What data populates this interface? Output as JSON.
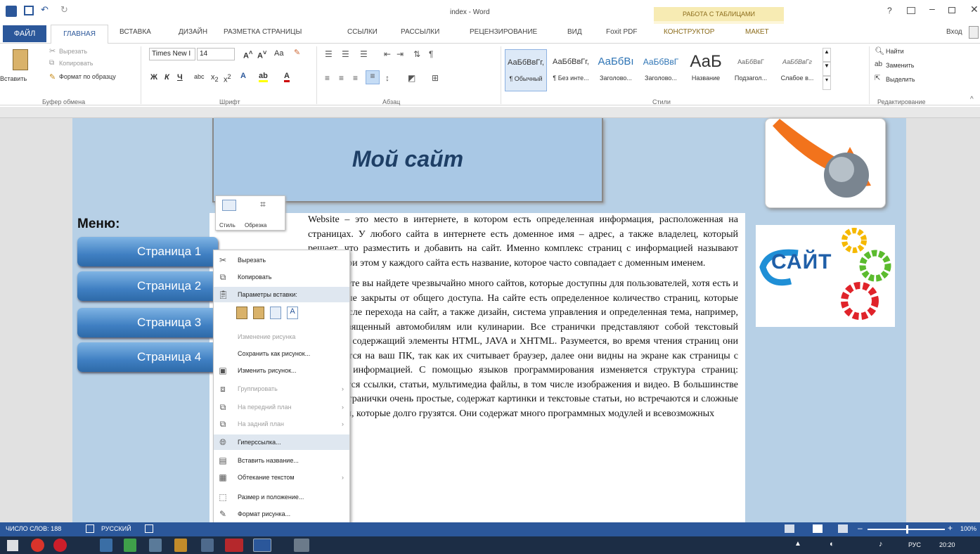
{
  "window": {
    "title": "index - Word",
    "table_tools": "РАБОТА С ТАБЛИЦАМИ",
    "help": "?",
    "signin": "Вход"
  },
  "tabs": {
    "file": "ФАЙЛ",
    "home": "ГЛАВНАЯ",
    "insert": "ВСТАВКА",
    "design": "ДИЗАЙН",
    "layout": "РАЗМЕТКА СТРАНИЦЫ",
    "references": "ССЫЛКИ",
    "mailings": "РАССЫЛКИ",
    "review": "РЕЦЕНЗИРОВАНИЕ",
    "view": "ВИД",
    "foxit": "Foxit PDF",
    "constructor": "КОНСТРУКТОР",
    "maket": "МАКЕТ"
  },
  "ribbon": {
    "clipboard": {
      "paste": "Вставить",
      "cut": "Вырезать",
      "copy": "Копировать",
      "format_painter": "Формат по образцу",
      "label": "Буфер обмена"
    },
    "font": {
      "name": "Times New I",
      "size": "14",
      "label": "Шрифт"
    },
    "paragraph": {
      "label": "Абзац"
    },
    "styles": {
      "items": [
        {
          "preview": "АаБбВвГг,",
          "name": "¶ Обычный"
        },
        {
          "preview": "АаБбВвГг,",
          "name": "¶ Без инте..."
        },
        {
          "preview": "АаБбВı",
          "name": "Заголово..."
        },
        {
          "preview": "АаБбВвГ",
          "name": "Заголово..."
        },
        {
          "preview": "АаБ",
          "name": "Название"
        },
        {
          "preview": "АаБбВвГ",
          "name": "Подзагол..."
        },
        {
          "preview": "АаБбВвГг",
          "name": "Слабое в..."
        }
      ],
      "label": "Стили"
    },
    "editing": {
      "find": "Найти",
      "replace": "Заменить",
      "select": "Выделить",
      "label": "Редактирование"
    }
  },
  "document": {
    "site_title": "Мой сайт",
    "menu_label": "Меню:",
    "menu_items": [
      "Страница 1",
      "Страница 2",
      "Страница 3",
      "Страница 4"
    ],
    "logo_text": "САЙТ",
    "paragraph1": "Website – это место в интернете, в котором есть определенная информация, расположенная на страницах. У любого сайта в интернете есть доменное имя – адрес, а также владелец, который решает, что разместить и добавить на сайт. Именно комплекс страниц с информацией называют сайтом, при этом у каждого сайта есть название, которое часто совпадает с доменным именем.",
    "paragraph2": "В интернете вы найдете чрезвычайно много сайтов, которые доступны для пользователей, хотя есть и те, которые закрыты от общего доступа. На сайте есть определенное количество страниц, которые видны после перехода на сайт, а также дизайн, система управления и определенная тема, например, сайт посвященный автомобилям или кулинарии. Все странички представляют собой текстовый документ, содержащий элементы HTML, JAVA и XHTML. Разумеется, во время чтения страниц они загружаются на ваш ПК, так как их считывает браузер, далее они видны на экране как страницы с полезной информацией. С помощью языков программирования изменяется структура страниц: вставляются ссылки, статьи, мультимедиа файлы, в том числе изображения и видео. В большинстве случаев странички очень простые, содержат картинки и текстовые статьи, но встречаются и сложные странички, которые долго грузятся. Они содержат много программных модулей и всевозможных"
  },
  "mini_toolbar": {
    "style": "Стиль",
    "crop": "Обрезка"
  },
  "context_menu": {
    "cut": "Вырезать",
    "copy": "Копировать",
    "paste_options": "Параметры вставки:",
    "change_picture_dis": "Изменение рисунка",
    "save_as_picture": "Сохранить как рисунок...",
    "change_picture": "Изменить рисунок...",
    "group": "Группировать",
    "bring_front": "На передний план",
    "send_back": "На задний план",
    "hyperlink": "Гиперссылка...",
    "insert_caption": "Вставить название...",
    "wrap_text": "Обтекание текстом",
    "size_position": "Размер и положение...",
    "format_picture": "Формат рисунка..."
  },
  "statusbar": {
    "word_count": "ЧИСЛО СЛОВ: 188",
    "language": "РУССКИЙ",
    "zoom": "100%"
  },
  "taskbar": {
    "lang": "РУС",
    "time": "20:20"
  }
}
